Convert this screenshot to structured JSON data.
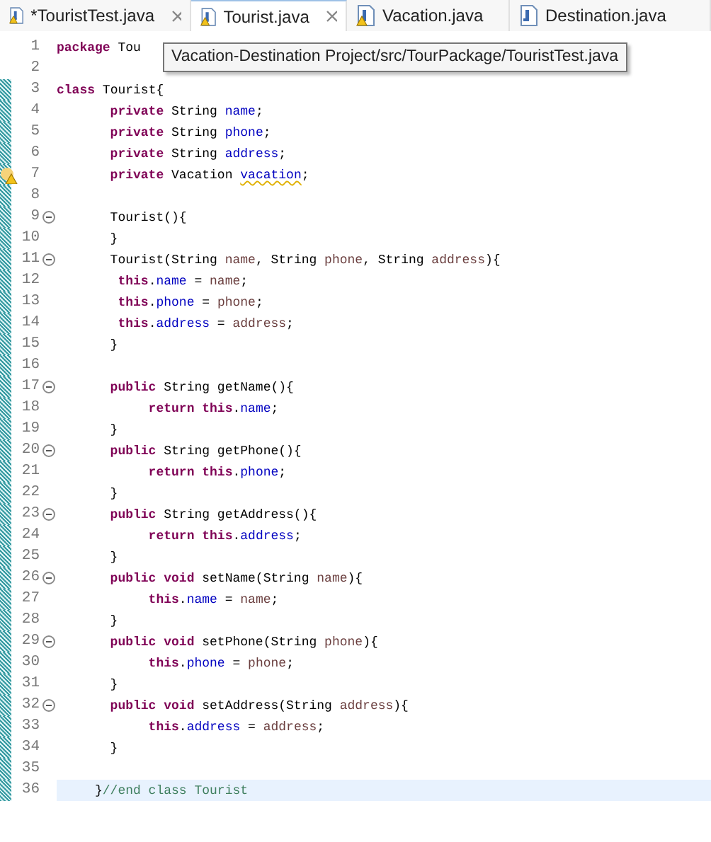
{
  "tabs": [
    {
      "label": "*TouristTest.java",
      "selected": false,
      "warning": true,
      "closable": true
    },
    {
      "label": "Tourist.java",
      "selected": true,
      "warning": true,
      "closable": true
    },
    {
      "label": "Vacation.java",
      "selected": false,
      "warning": true,
      "closable": false
    },
    {
      "label": "Destination.java",
      "selected": false,
      "warning": false,
      "closable": false
    }
  ],
  "tooltip": "Vacation-Destination Project/src/TourPackage/TouristTest.java",
  "lines": [
    {
      "number": "1",
      "tokens": [
        {
          "text": "package",
          "kind": "kw"
        },
        {
          "text": " Tou",
          "kind": "plain"
        }
      ],
      "fold": false,
      "changed": false,
      "warning": false,
      "current": false
    },
    {
      "number": "2",
      "fold": false,
      "changed": false,
      "warning": false,
      "current": false
    },
    {
      "number": "3",
      "tokens": [
        {
          "text": "class",
          "kind": "kw"
        },
        {
          "text": " Tourist{",
          "kind": "plain"
        }
      ],
      "fold": false,
      "changed": true,
      "warning": false,
      "current": false
    },
    {
      "number": "4",
      "tokens": [
        {
          "text": "       private",
          "kind": "kw"
        },
        {
          "text": " String ",
          "kind": "plain"
        },
        {
          "text": "name",
          "kind": "field"
        },
        {
          "text": ";",
          "kind": "plain"
        }
      ],
      "fold": false,
      "changed": true,
      "warning": false,
      "current": false
    },
    {
      "number": "5",
      "tokens": [
        {
          "text": "       private",
          "kind": "kw"
        },
        {
          "text": " String ",
          "kind": "plain"
        },
        {
          "text": "phone",
          "kind": "field"
        },
        {
          "text": ";",
          "kind": "plain"
        }
      ],
      "fold": false,
      "changed": true,
      "warning": false,
      "current": false
    },
    {
      "number": "6",
      "tokens": [
        {
          "text": "       private",
          "kind": "kw"
        },
        {
          "text": " String ",
          "kind": "plain"
        },
        {
          "text": "address",
          "kind": "field"
        },
        {
          "text": ";",
          "kind": "plain"
        }
      ],
      "fold": false,
      "changed": true,
      "warning": false,
      "current": false
    },
    {
      "number": "7",
      "tokens": [
        {
          "text": "       private",
          "kind": "kw"
        },
        {
          "text": " Vacation ",
          "kind": "plain"
        },
        {
          "text": "vacation",
          "kind": "warn"
        },
        {
          "text": ";",
          "kind": "plain"
        }
      ],
      "fold": false,
      "changed": true,
      "warning": true,
      "current": false
    },
    {
      "number": "8",
      "fold": false,
      "changed": true,
      "warning": false,
      "current": false
    },
    {
      "number": "9",
      "tokens": [
        {
          "text": "       Tourist(){",
          "kind": "plain"
        }
      ],
      "fold": true,
      "changed": true,
      "warning": false,
      "current": false
    },
    {
      "number": "10",
      "tokens": [
        {
          "text": "       }",
          "kind": "plain"
        }
      ],
      "fold": false,
      "changed": true,
      "warning": false,
      "current": false
    },
    {
      "number": "11",
      "tokens": [
        {
          "text": "       Tourist(String ",
          "kind": "plain"
        },
        {
          "text": "name",
          "kind": "param"
        },
        {
          "text": ", String ",
          "kind": "plain"
        },
        {
          "text": "phone",
          "kind": "param"
        },
        {
          "text": ", String ",
          "kind": "plain"
        },
        {
          "text": "address",
          "kind": "param"
        },
        {
          "text": "){",
          "kind": "plain"
        }
      ],
      "fold": true,
      "changed": true,
      "warning": false,
      "current": false
    },
    {
      "number": "12",
      "tokens": [
        {
          "text": "        this",
          "kind": "kw"
        },
        {
          "text": ".",
          "kind": "plain"
        },
        {
          "text": "name",
          "kind": "field"
        },
        {
          "text": " = ",
          "kind": "plain"
        },
        {
          "text": "name",
          "kind": "param"
        },
        {
          "text": ";",
          "kind": "plain"
        }
      ],
      "fold": false,
      "changed": true,
      "warning": false,
      "current": false
    },
    {
      "number": "13",
      "tokens": [
        {
          "text": "        this",
          "kind": "kw"
        },
        {
          "text": ".",
          "kind": "plain"
        },
        {
          "text": "phone",
          "kind": "field"
        },
        {
          "text": " = ",
          "kind": "plain"
        },
        {
          "text": "phone",
          "kind": "param"
        },
        {
          "text": ";",
          "kind": "plain"
        }
      ],
      "fold": false,
      "changed": true,
      "warning": false,
      "current": false
    },
    {
      "number": "14",
      "tokens": [
        {
          "text": "        this",
          "kind": "kw"
        },
        {
          "text": ".",
          "kind": "plain"
        },
        {
          "text": "address",
          "kind": "field"
        },
        {
          "text": " = ",
          "kind": "plain"
        },
        {
          "text": "address",
          "kind": "param"
        },
        {
          "text": ";",
          "kind": "plain"
        }
      ],
      "fold": false,
      "changed": true,
      "warning": false,
      "current": false
    },
    {
      "number": "15",
      "tokens": [
        {
          "text": "       }",
          "kind": "plain"
        }
      ],
      "fold": false,
      "changed": true,
      "warning": false,
      "current": false
    },
    {
      "number": "16",
      "fold": false,
      "changed": true,
      "warning": false,
      "current": false
    },
    {
      "number": "17",
      "tokens": [
        {
          "text": "       public",
          "kind": "kw"
        },
        {
          "text": " String getName(){",
          "kind": "plain"
        }
      ],
      "fold": true,
      "changed": true,
      "warning": false,
      "current": false
    },
    {
      "number": "18",
      "tokens": [
        {
          "text": "            return this",
          "kind": "kw"
        },
        {
          "text": ".",
          "kind": "plain"
        },
        {
          "text": "name",
          "kind": "field"
        },
        {
          "text": ";",
          "kind": "plain"
        }
      ],
      "fold": false,
      "changed": true,
      "warning": false,
      "current": false
    },
    {
      "number": "19",
      "tokens": [
        {
          "text": "       }",
          "kind": "plain"
        }
      ],
      "fold": false,
      "changed": true,
      "warning": false,
      "current": false
    },
    {
      "number": "20",
      "tokens": [
        {
          "text": "       public",
          "kind": "kw"
        },
        {
          "text": " String getPhone(){",
          "kind": "plain"
        }
      ],
      "fold": true,
      "changed": true,
      "warning": false,
      "current": false
    },
    {
      "number": "21",
      "tokens": [
        {
          "text": "            return this",
          "kind": "kw"
        },
        {
          "text": ".",
          "kind": "plain"
        },
        {
          "text": "phone",
          "kind": "field"
        },
        {
          "text": ";",
          "kind": "plain"
        }
      ],
      "fold": false,
      "changed": true,
      "warning": false,
      "current": false
    },
    {
      "number": "22",
      "tokens": [
        {
          "text": "       }",
          "kind": "plain"
        }
      ],
      "fold": false,
      "changed": true,
      "warning": false,
      "current": false
    },
    {
      "number": "23",
      "tokens": [
        {
          "text": "       public",
          "kind": "kw"
        },
        {
          "text": " String getAddress(){",
          "kind": "plain"
        }
      ],
      "fold": true,
      "changed": true,
      "warning": false,
      "current": false
    },
    {
      "number": "24",
      "tokens": [
        {
          "text": "            return this",
          "kind": "kw"
        },
        {
          "text": ".",
          "kind": "plain"
        },
        {
          "text": "address",
          "kind": "field"
        },
        {
          "text": ";",
          "kind": "plain"
        }
      ],
      "fold": false,
      "changed": true,
      "warning": false,
      "current": false
    },
    {
      "number": "25",
      "tokens": [
        {
          "text": "       }",
          "kind": "plain"
        }
      ],
      "fold": false,
      "changed": true,
      "warning": false,
      "current": false
    },
    {
      "number": "26",
      "tokens": [
        {
          "text": "       public void",
          "kind": "kw"
        },
        {
          "text": " setName(String ",
          "kind": "plain"
        },
        {
          "text": "name",
          "kind": "param"
        },
        {
          "text": "){",
          "kind": "plain"
        }
      ],
      "fold": true,
      "changed": true,
      "warning": false,
      "current": false
    },
    {
      "number": "27",
      "tokens": [
        {
          "text": "            this",
          "kind": "kw"
        },
        {
          "text": ".",
          "kind": "plain"
        },
        {
          "text": "name",
          "kind": "field"
        },
        {
          "text": " = ",
          "kind": "plain"
        },
        {
          "text": "name",
          "kind": "param"
        },
        {
          "text": ";",
          "kind": "plain"
        }
      ],
      "fold": false,
      "changed": true,
      "warning": false,
      "current": false
    },
    {
      "number": "28",
      "tokens": [
        {
          "text": "       }",
          "kind": "plain"
        }
      ],
      "fold": false,
      "changed": true,
      "warning": false,
      "current": false
    },
    {
      "number": "29",
      "tokens": [
        {
          "text": "       public void",
          "kind": "kw"
        },
        {
          "text": " setPhone(String ",
          "kind": "plain"
        },
        {
          "text": "phone",
          "kind": "param"
        },
        {
          "text": "){",
          "kind": "plain"
        }
      ],
      "fold": true,
      "changed": true,
      "warning": false,
      "current": false
    },
    {
      "number": "30",
      "tokens": [
        {
          "text": "            this",
          "kind": "kw"
        },
        {
          "text": ".",
          "kind": "plain"
        },
        {
          "text": "phone",
          "kind": "field"
        },
        {
          "text": " = ",
          "kind": "plain"
        },
        {
          "text": "phone",
          "kind": "param"
        },
        {
          "text": ";",
          "kind": "plain"
        }
      ],
      "fold": false,
      "changed": true,
      "warning": false,
      "current": false
    },
    {
      "number": "31",
      "tokens": [
        {
          "text": "       }",
          "kind": "plain"
        }
      ],
      "fold": false,
      "changed": true,
      "warning": false,
      "current": false
    },
    {
      "number": "32",
      "tokens": [
        {
          "text": "       public void",
          "kind": "kw"
        },
        {
          "text": " setAddress(String ",
          "kind": "plain"
        },
        {
          "text": "address",
          "kind": "param"
        },
        {
          "text": "){",
          "kind": "plain"
        }
      ],
      "fold": true,
      "changed": true,
      "warning": false,
      "current": false
    },
    {
      "number": "33",
      "tokens": [
        {
          "text": "            this",
          "kind": "kw"
        },
        {
          "text": ".",
          "kind": "plain"
        },
        {
          "text": "address",
          "kind": "field"
        },
        {
          "text": " = ",
          "kind": "plain"
        },
        {
          "text": "address",
          "kind": "param"
        },
        {
          "text": ";",
          "kind": "plain"
        }
      ],
      "fold": false,
      "changed": true,
      "warning": false,
      "current": false
    },
    {
      "number": "34",
      "tokens": [
        {
          "text": "       }",
          "kind": "plain"
        }
      ],
      "fold": false,
      "changed": true,
      "warning": false,
      "current": false
    },
    {
      "number": "35",
      "fold": false,
      "changed": true,
      "warning": false,
      "current": false
    },
    {
      "number": "36",
      "tokens": [
        {
          "text": "     }",
          "kind": "plain"
        },
        {
          "text": "//end class Tourist",
          "kind": "comment"
        }
      ],
      "fold": false,
      "changed": true,
      "warning": false,
      "current": true
    }
  ]
}
